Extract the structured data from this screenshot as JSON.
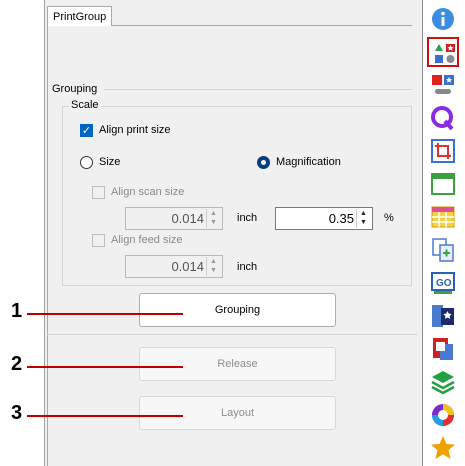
{
  "tab": {
    "label": "PrintGroup"
  },
  "grouping": {
    "label": "Grouping",
    "scale": {
      "label": "Scale",
      "align_print_size": {
        "label": "Align print size",
        "checked": true
      },
      "size_option": {
        "label": "Size",
        "selected": false
      },
      "magnification_option": {
        "label": "Magnification",
        "selected": true
      },
      "align_scan_size": {
        "label": "Align scan size",
        "checked": false
      },
      "scan_value": "0.014",
      "scan_unit": "inch",
      "magnification_value": "0.35",
      "magnification_unit": "%",
      "align_feed_size": {
        "label": "Align feed size",
        "checked": false
      },
      "feed_value": "0.014",
      "feed_unit": "inch"
    }
  },
  "buttons": {
    "grouping": "Grouping",
    "release": "Release",
    "layout": "Layout"
  },
  "callouts": [
    "1",
    "2",
    "3"
  ],
  "toolbar": {
    "items": [
      {
        "icon": "info-icon",
        "color": "#3a8de0"
      },
      {
        "icon": "group-shapes-icon",
        "color": "#d01010",
        "selected": true
      },
      {
        "icon": "color-squares-icon",
        "color": "#e02020"
      },
      {
        "icon": "query-q-icon",
        "color": "#8a2be2"
      },
      {
        "icon": "crop-icon",
        "color": "#e03030"
      },
      {
        "icon": "tray-icon",
        "color": "#3aa040"
      },
      {
        "icon": "table-icon",
        "color": "#d0a000"
      },
      {
        "icon": "copy-pages-icon",
        "color": "#4a7ad0"
      },
      {
        "icon": "go-icon",
        "color": "#2a60c0"
      },
      {
        "icon": "star-box-icon",
        "color": "#1a2a6a"
      },
      {
        "icon": "red-card-icon",
        "color": "#d02020"
      },
      {
        "icon": "layers-icon",
        "color": "#20a040"
      },
      {
        "icon": "color-wheel-icon",
        "color": "#7a2ad0"
      },
      {
        "icon": "favorite-star-icon",
        "color": "#f0a000"
      }
    ]
  }
}
